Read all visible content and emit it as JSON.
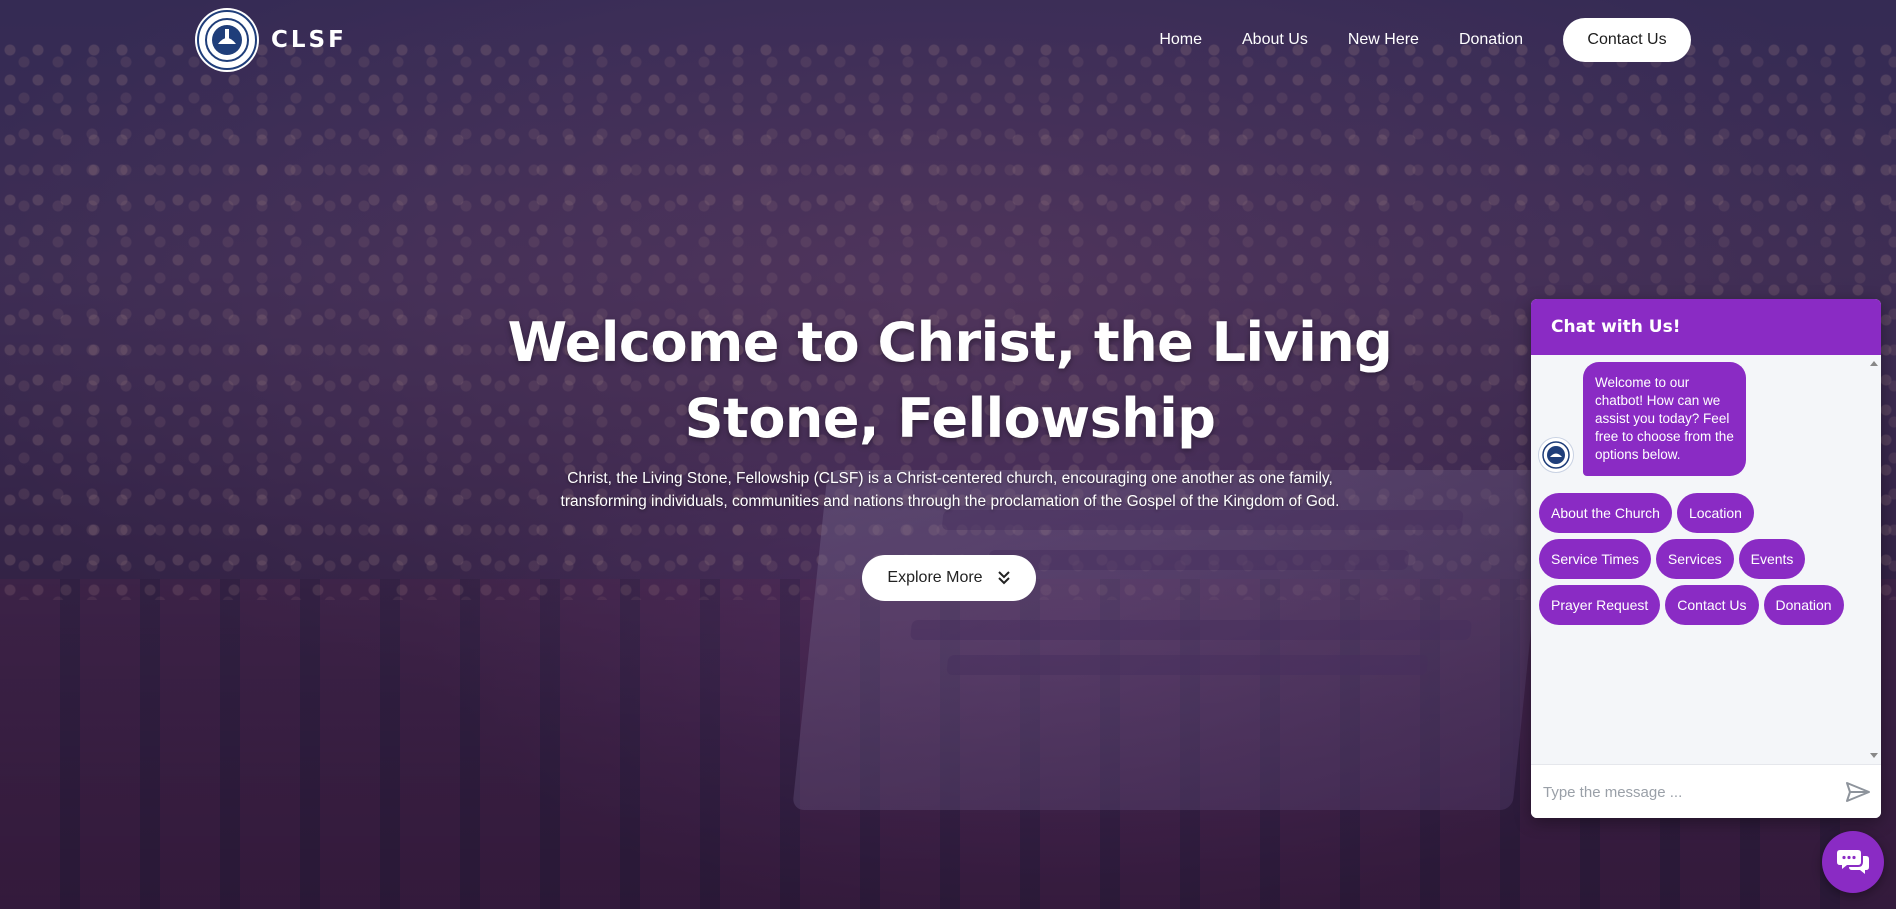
{
  "brand": {
    "name": "CLSF"
  },
  "nav": {
    "links": [
      "Home",
      "About Us",
      "New Here",
      "Donation"
    ],
    "contact_label": "Contact Us"
  },
  "hero": {
    "title": "Welcome to Christ, the Living Stone, Fellowship",
    "description": "Christ, the Living Stone, Fellowship (CLSF) is a Christ-centered church, encouraging one another as one family, transforming individuals, communities and nations through the proclamation of the Gospel of the Kingdom of God.",
    "explore_label": "Explore More"
  },
  "chat": {
    "title": "Chat with Us!",
    "welcome": "Welcome to our chatbot! How can we assist you today? Feel free to choose from the options below.",
    "options": [
      [
        "About the Church",
        "Location"
      ],
      [
        "Service Times",
        "Services",
        "Events"
      ],
      [
        "Prayer Request",
        "Contact Us",
        "Donation"
      ]
    ],
    "input_placeholder": "Type the message ...",
    "accent": "#8a2bc4"
  },
  "icons": {
    "explore": "double-chevron-down-icon",
    "send": "send-icon",
    "launcher": "chat-bubbles-icon"
  }
}
